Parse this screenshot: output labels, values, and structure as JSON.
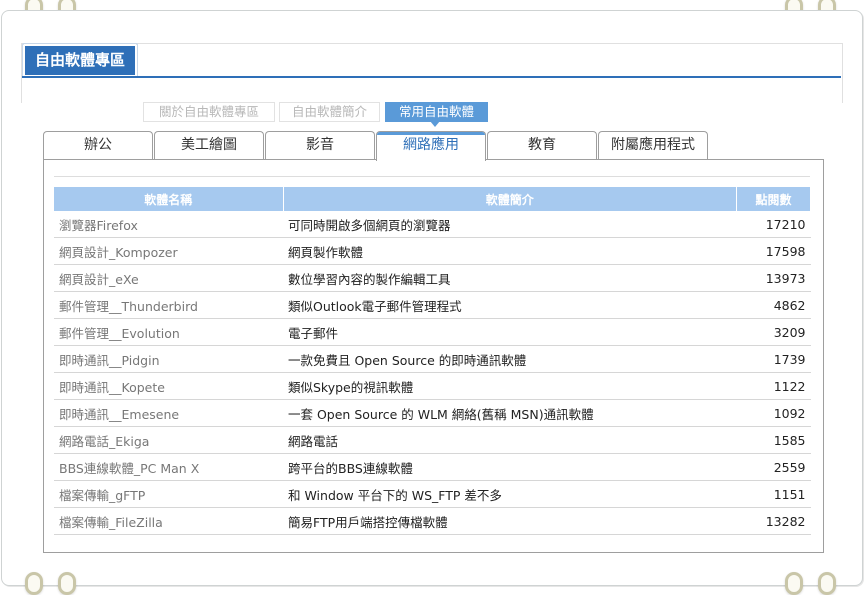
{
  "section_title": "自由軟體專區",
  "sub_tabs": [
    {
      "label": "關於自由軟體專區",
      "active": false
    },
    {
      "label": "自由軟體簡介",
      "active": false
    },
    {
      "label": "常用自由軟體",
      "active": true
    }
  ],
  "category_tabs": [
    {
      "label": "辦公",
      "active": false
    },
    {
      "label": "美工繪圖",
      "active": false
    },
    {
      "label": "影音",
      "active": false
    },
    {
      "label": "網路應用",
      "active": true
    },
    {
      "label": "教育",
      "active": false
    },
    {
      "label": "附屬應用程式",
      "active": false
    }
  ],
  "table": {
    "headers": [
      "軟體名稱",
      "軟體簡介",
      "點閱數"
    ],
    "rows": [
      {
        "name": "瀏覽器Firefox",
        "desc": "可同時開啟多個網頁的瀏覽器",
        "views": "17210"
      },
      {
        "name": "網頁設計_Kompozer",
        "desc": "網頁製作軟體",
        "views": "17598"
      },
      {
        "name": "網頁設計_eXe",
        "desc": "數位學習內容的製作編輯工具",
        "views": "13973"
      },
      {
        "name": "郵件管理__Thunderbird",
        "desc": "類似Outlook電子郵件管理程式",
        "views": "4862"
      },
      {
        "name": "郵件管理__Evolution",
        "desc": "電子郵件",
        "views": "3209"
      },
      {
        "name": "即時通訊__Pidgin",
        "desc": "一款免費且 Open Source 的即時通訊軟體",
        "views": "1739"
      },
      {
        "name": "即時通訊__Kopete",
        "desc": "類似Skype的視訊軟體",
        "views": "1122"
      },
      {
        "name": "即時通訊__Emesene",
        "desc": "一套 Open Source 的 WLM 網絡(舊稱 MSN)通訊軟體",
        "views": "1092"
      },
      {
        "name": "網路電話_Ekiga",
        "desc": "網路電話",
        "views": "1585"
      },
      {
        "name": "BBS連線軟體_PC Man X",
        "desc": "跨平台的BBS連線軟體",
        "views": "2559"
      },
      {
        "name": "檔案傳輸_gFTP",
        "desc": "和 Window 平台下的 WS_FTP 差不多",
        "views": "1151"
      },
      {
        "name": "檔案傳輸_FileZilla",
        "desc": "簡易FTP用戶端搭控傳檔軟體",
        "views": "13282"
      }
    ]
  },
  "colors": {
    "title_blue": "#2e6fb8",
    "tab_highlight": "#5a9ad8",
    "table_header": "#a6c9ef"
  }
}
